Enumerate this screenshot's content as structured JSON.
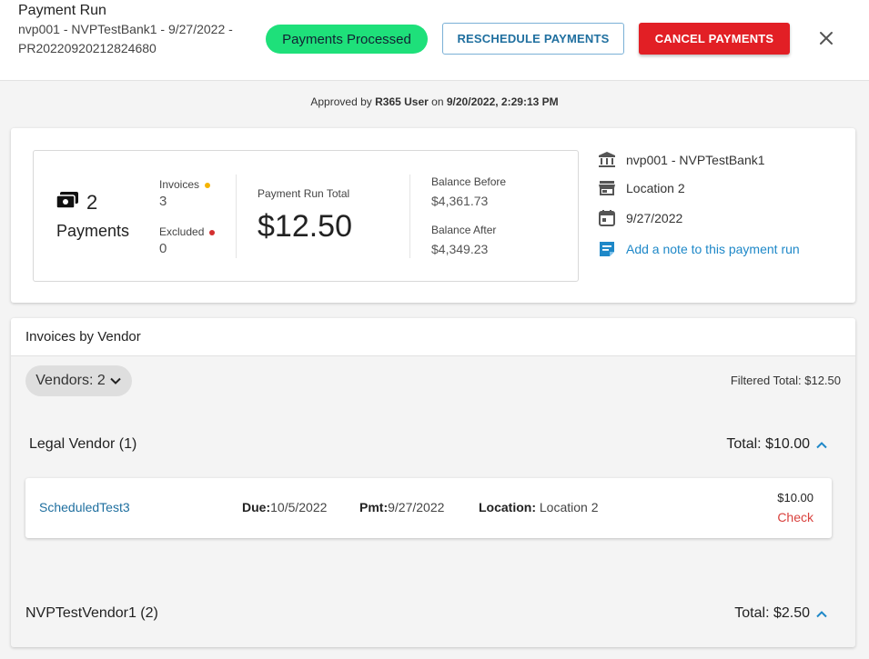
{
  "header": {
    "title": "Payment Run",
    "subtitle_line1": "nvp001 - NVPTestBank1 - 9/27/2022 -",
    "subtitle_line2": "PR20220920212824680",
    "status_badge": "Payments Processed",
    "reschedule_label": "RESCHEDULE PAYMENTS",
    "cancel_label": "CANCEL PAYMENTS"
  },
  "approval": {
    "prefix": "Approved by",
    "user": "R365 User",
    "on": "on",
    "datetime": "9/20/2022, 2:29:13 PM"
  },
  "summary": {
    "payments_count": "2",
    "payments_label": "Payments",
    "invoices_label": "Invoices",
    "invoices_value": "3",
    "excluded_label": "Excluded",
    "excluded_value": "0",
    "run_total_label": "Payment Run Total",
    "run_total_value": "$12.50",
    "balance_before_label": "Balance Before",
    "balance_before_value": "$4,361.73",
    "balance_after_label": "Balance After",
    "balance_after_value": "$4,349.23"
  },
  "details": {
    "bank": "nvp001 - NVPTestBank1",
    "location": "Location 2",
    "date": "9/27/2022",
    "note_link": "Add a note to this payment run"
  },
  "vendors": {
    "section_title": "Invoices by Vendor",
    "chip_label": "Vendors: 2",
    "filtered_total": "Filtered Total: $12.50",
    "groups": [
      {
        "name": "Legal Vendor (1)",
        "total": "Total: $10.00",
        "invoices": [
          {
            "number": "ScheduledTest3",
            "due_label": "Due:",
            "due_value": "10/5/2022",
            "pmt_label": "Pmt:",
            "pmt_value": "9/27/2022",
            "location_label": "Location:",
            "location_value": "Location 2",
            "amount": "$10.00",
            "method": "Check"
          }
        ]
      },
      {
        "name": "NVPTestVendor1 (2)",
        "total": "Total: $2.50"
      }
    ]
  },
  "colors": {
    "processed_green": "#1ee07a",
    "cancel_red": "#e21f25",
    "link_blue": "#1e88c8",
    "invoices_dot": "#f5b400",
    "excluded_dot": "#d32f2f",
    "method_red": "#d9413d"
  },
  "icons": {
    "close": "close-icon",
    "payments": "payments-icon",
    "bank": "bank-icon",
    "store": "store-icon",
    "calendar": "calendar-icon",
    "note": "note-icon",
    "chip_chevron": "chevron-down-icon",
    "group_chevron": "chevron-up-icon"
  }
}
